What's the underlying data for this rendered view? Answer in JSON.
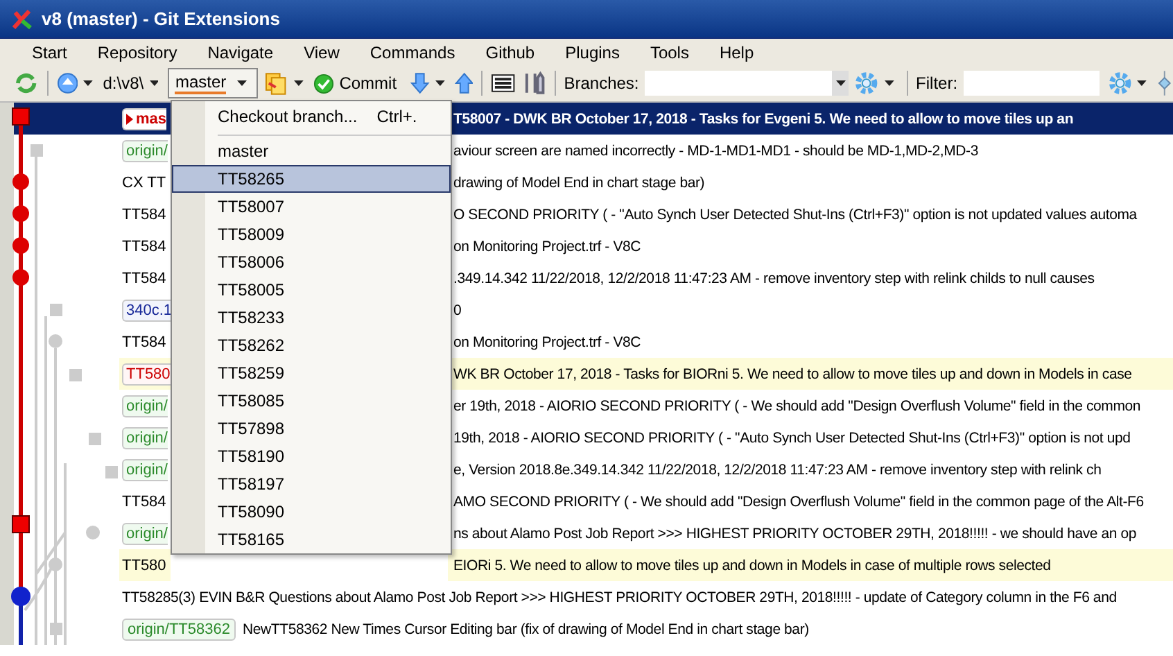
{
  "window": {
    "title": "v8 (master) - Git Extensions"
  },
  "menu": [
    "Start",
    "Repository",
    "Navigate",
    "View",
    "Commands",
    "Github",
    "Plugins",
    "Tools",
    "Help"
  ],
  "toolbar": {
    "repo": "d:\\v8\\",
    "branch": "master",
    "branch_pressed": true,
    "commit": "Commit",
    "branches_label": "Branches:",
    "filter_label": "Filter:"
  },
  "branch_menu": {
    "checkout": "Checkout branch...",
    "shortcut": "Ctrl+.",
    "items": [
      {
        "label": "master",
        "selected": false
      },
      {
        "label": "TT58265",
        "selected": true
      },
      {
        "label": "TT58007",
        "selected": false
      },
      {
        "label": "TT58009",
        "selected": false
      },
      {
        "label": "TT58006",
        "selected": false
      },
      {
        "label": "TT58005",
        "selected": false
      },
      {
        "label": "TT58233",
        "selected": false
      },
      {
        "label": "TT58262",
        "selected": false
      },
      {
        "label": "TT58259",
        "selected": false
      },
      {
        "label": "TT58085",
        "selected": false
      },
      {
        "label": "TT57898",
        "selected": false
      },
      {
        "label": "TT58190",
        "selected": false
      },
      {
        "label": "TT58197",
        "selected": false
      },
      {
        "label": "TT58090",
        "selected": false
      },
      {
        "label": "TT58165",
        "selected": false
      }
    ]
  },
  "commits": [
    {
      "kind": "split",
      "selected": true,
      "highlight": false,
      "ref": {
        "kind": "head",
        "text": "mas"
      },
      "message": "T58007 - DWK BR October 17, 2018 - Tasks for Evgeni 5. We need to allow to move tiles up an"
    },
    {
      "kind": "split",
      "selected": false,
      "highlight": false,
      "ref": {
        "kind": "remote",
        "text": "origin/"
      },
      "message": "aviour screen are named incorrectly - MD-1-MD1-MD1 - should be MD-1,MD-2,MD-3"
    },
    {
      "kind": "split",
      "selected": false,
      "highlight": false,
      "lead": "CX TT",
      "message": "drawing of Model End in chart stage bar)"
    },
    {
      "kind": "split",
      "selected": false,
      "highlight": false,
      "lead": "TT584",
      "message": "O SECOND PRIORITY ( - \"Auto Synch User Detected Shut-Ins (Ctrl+F3)\" option is not updated values automa"
    },
    {
      "kind": "split",
      "selected": false,
      "highlight": false,
      "lead": "TT584",
      "message": "on Monitoring Project.trf - V8C"
    },
    {
      "kind": "split",
      "selected": false,
      "highlight": false,
      "lead": "TT584",
      "message": ".349.14.342   11/22/2018, 12/2/2018 11:47:23 AM - remove inventory step with relink childs to null causes"
    },
    {
      "kind": "split",
      "selected": false,
      "highlight": false,
      "ref": {
        "kind": "tag",
        "text": "340c.1"
      },
      "message": "0"
    },
    {
      "kind": "split",
      "selected": false,
      "highlight": false,
      "lead": "TT584",
      "message": "on Monitoring Project.trf - V8C"
    },
    {
      "kind": "split",
      "selected": false,
      "highlight": true,
      "ref": {
        "kind": "local",
        "text": "TT580"
      },
      "message": "WK BR October 17, 2018 - Tasks for BIORni 5. We need to allow to move tiles up and down in Models in case"
    },
    {
      "kind": "split",
      "selected": false,
      "highlight": false,
      "ref": {
        "kind": "remote",
        "text": "origin/"
      },
      "message": "er 19th, 2018 - AIORIO SECOND PRIORITY ( - We should add \"Design Overflush Volume\" field in the common"
    },
    {
      "kind": "split",
      "selected": false,
      "highlight": false,
      "ref": {
        "kind": "remote",
        "text": "origin/"
      },
      "message": "19th, 2018 - AIORIO SECOND PRIORITY ( - \"Auto Synch User Detected Shut-Ins (Ctrl+F3)\" option is not upd"
    },
    {
      "kind": "split",
      "selected": false,
      "highlight": false,
      "ref": {
        "kind": "remote",
        "text": "origin/"
      },
      "message": "e, Version 2018.8e.349.14.342   11/22/2018, 12/2/2018 11:47:23 AM - remove inventory step with relink ch"
    },
    {
      "kind": "split",
      "selected": false,
      "highlight": false,
      "lead": "TT584",
      "message": "AMO SECOND PRIORITY ( - We should add \"Design Overflush Volume\" field in the common page of the Alt-F6"
    },
    {
      "kind": "split",
      "selected": false,
      "highlight": false,
      "ref": {
        "kind": "remote",
        "text": "origin/"
      },
      "message": "ns about Alamo Post Job Report >>> HIGHEST PRIORITY OCTOBER 29TH, 2018!!!!! - we should have an op"
    },
    {
      "kind": "split",
      "selected": false,
      "highlight": true,
      "lead": "TT580",
      "message": "EIORi 5. We need to allow to move tiles up and down in Models in case of multiple rows selected"
    },
    {
      "kind": "full",
      "selected": false,
      "highlight": false,
      "message": "TT58285(3) EVIN B&R Questions about Alamo Post Job Report >>> HIGHEST PRIORITY OCTOBER 29TH, 2018!!!!! - update of Category column in the F6 and"
    },
    {
      "kind": "full",
      "selected": false,
      "highlight": false,
      "ref": {
        "kind": "remote",
        "text": "origin/TT58362"
      },
      "message": "NewTT58362 New Times Cursor Editing bar (fix of drawing of Model End in chart stage bar)"
    }
  ]
}
